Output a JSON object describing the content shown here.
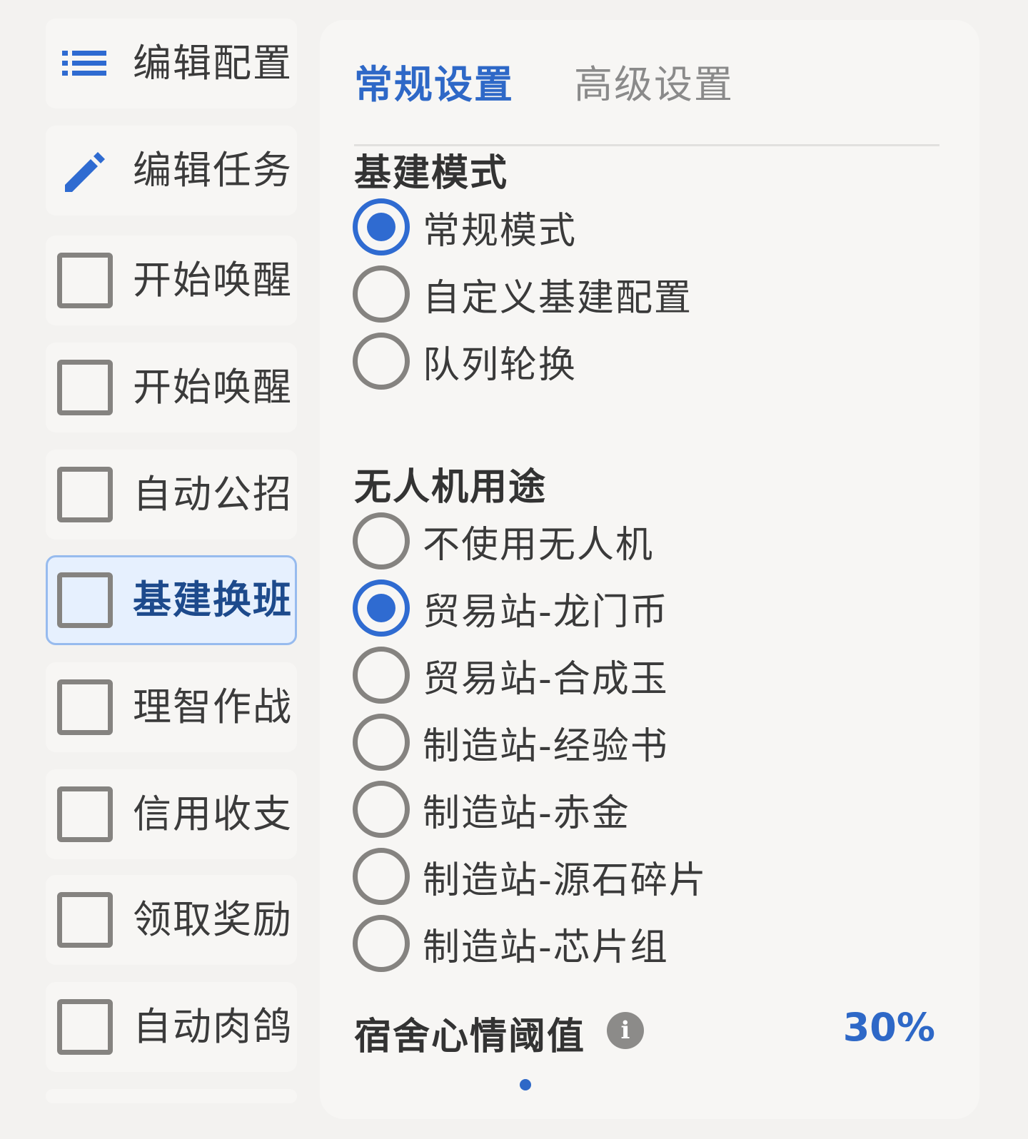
{
  "sidebar": {
    "items": [
      {
        "label": "编辑配置",
        "icon": "list-icon"
      },
      {
        "label": "编辑任务",
        "icon": "pencil-icon"
      },
      {
        "label": "开始唤醒",
        "checked": false
      },
      {
        "label": "开始唤醒",
        "checked": false
      },
      {
        "label": "自动公招",
        "checked": false
      },
      {
        "label": "基建换班",
        "checked": false,
        "selected": true
      },
      {
        "label": "理智作战",
        "checked": false
      },
      {
        "label": "信用收支",
        "checked": false
      },
      {
        "label": "领取奖励",
        "checked": false
      },
      {
        "label": "自动肉鸽",
        "checked": false
      }
    ]
  },
  "tabs": {
    "general": "常规设置",
    "advanced": "高级设置",
    "active": "general"
  },
  "infrastructure_mode": {
    "title": "基建模式",
    "options": [
      "常规模式",
      "自定义基建配置",
      "队列轮换"
    ],
    "selected": "常规模式"
  },
  "drone_usage": {
    "title": "无人机用途",
    "options": [
      "不使用无人机",
      "贸易站-龙门币",
      "贸易站-合成玉",
      "制造站-经验书",
      "制造站-赤金",
      "制造站-源石碎片",
      "制造站-芯片组"
    ],
    "selected": "贸易站-龙门币"
  },
  "dorm_mood": {
    "title": "宿舍心情阈值",
    "value": "30%",
    "info_icon": "i"
  },
  "colors": {
    "accent": "#2e68c7",
    "selected_bg": "#e6f0fe",
    "selected_border": "#97bbee"
  }
}
